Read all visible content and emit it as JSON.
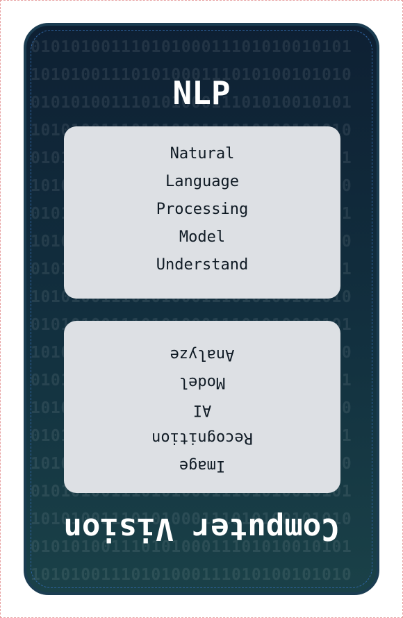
{
  "binary_rows": [
    "01010100111010100011101010010101",
    "10101001110101000111010100101010",
    "01010100111010100011101010010101",
    "10101001110101000111010100101010",
    "01010100111010100011101010010101",
    "10101001110101000111010100101010",
    "01010100111010100011101010010101",
    "10101001110101000111010100101010",
    "01010100111010100011101010010101",
    "10101001110101000111010100101010",
    "01010100111010100011101010010101",
    "10101001110101000111010100101010",
    "01010100111010100011101010010101",
    "10101001110101000111010100101010",
    "01010100111010100011101010010101",
    "10101001110101000111010100101010",
    "01010100111010100011101010010101",
    "10101001110101000111010100101010",
    "01010100111010100011101010010101",
    "10101001110101000111010100101010"
  ],
  "top_section": {
    "title": "NLP",
    "words": [
      "Natural",
      "Language",
      "Processing",
      "Model",
      "Understand"
    ]
  },
  "bottom_section": {
    "title": "Computer Vision",
    "words": [
      "Image",
      "Recognition",
      "AI",
      "Model",
      "Analyze"
    ]
  },
  "colors": {
    "card_top": "#0e2033",
    "card_bottom": "#1a4148",
    "panel": "#dde0e4",
    "text_dark": "#0f1a24",
    "title": "#ffffff"
  }
}
